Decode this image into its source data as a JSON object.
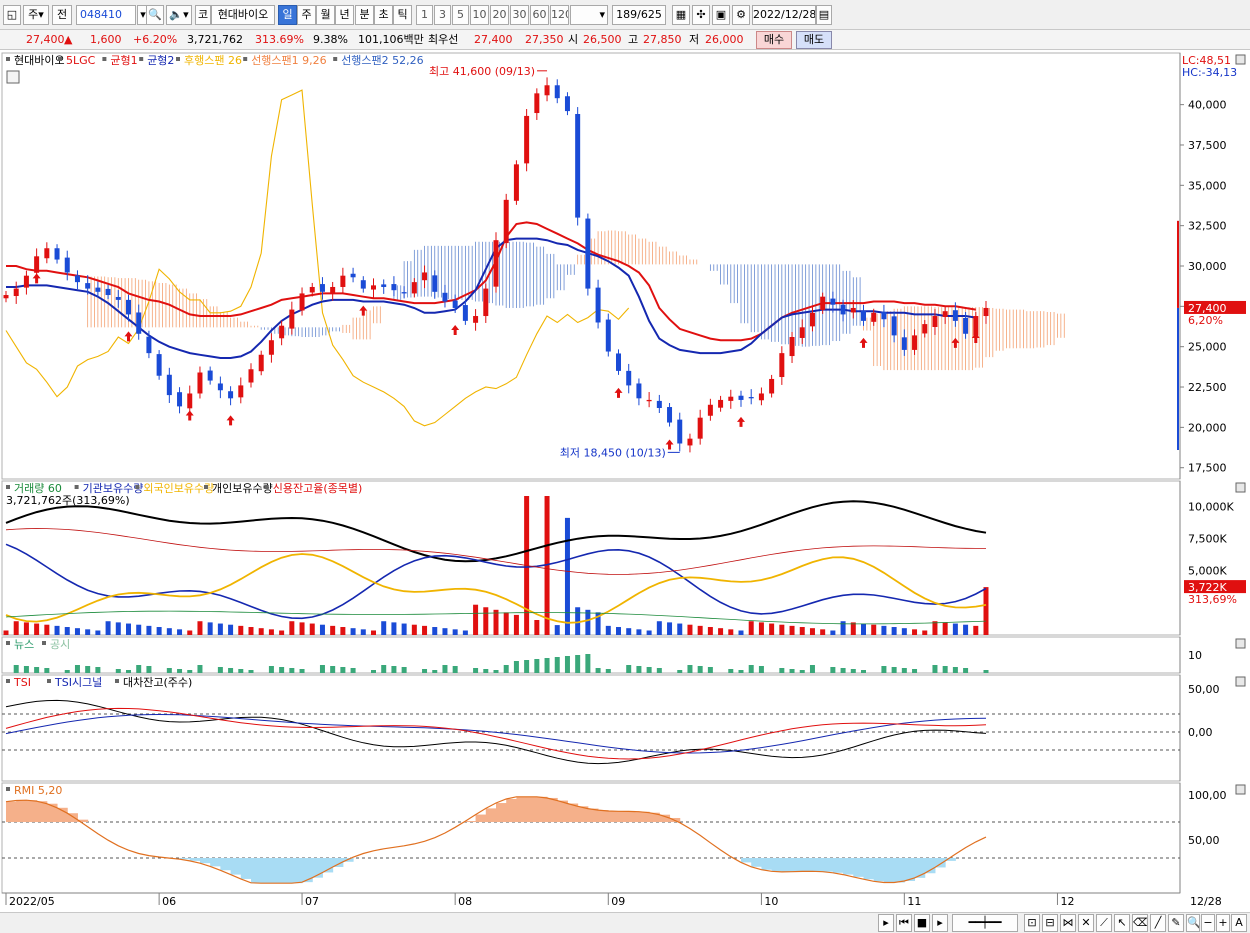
{
  "toolbar": {
    "mode_label": "주",
    "prev_label": "전",
    "stock_code": "048410",
    "code_btn": "코",
    "stock_name": "현대바이오",
    "periods": [
      "일",
      "주",
      "월",
      "년",
      "분",
      "초",
      "틱"
    ],
    "selected_period": "일",
    "intervals": [
      "1",
      "3",
      "5",
      "10",
      "20",
      "30",
      "60",
      "120"
    ],
    "count": "189/625",
    "date": "2022/12/28"
  },
  "pricebar": {
    "price": "27,400",
    "change": "1,600",
    "change_pct": "+6.20%",
    "volume": "3,721,762",
    "vol_ratio": "313.69%",
    "turnover": "9.38%",
    "amount": "101,106백만",
    "best_label": "최우선",
    "best_ask": "27,400",
    "best_bid": "27,350",
    "open_label": "시",
    "open": "26,500",
    "high_label": "고",
    "high": "27,850",
    "low_label": "저",
    "low": "26,000",
    "buy_label": "매수",
    "sell_label": "매도"
  },
  "legend_main": [
    {
      "text": "현대바이오",
      "color": "#000000"
    },
    {
      "text": "5LGC",
      "color": "#e01010"
    },
    {
      "text": "균형1",
      "color": "#e01010"
    },
    {
      "text": "균형2",
      "color": "#1528b0"
    },
    {
      "text": "후행스팬 26",
      "color": "#f0b400"
    },
    {
      "text": "선행스팬1 9,26",
      "color": "#f08040"
    },
    {
      "text": "선행스팬2 52,26",
      "color": "#3060c0"
    }
  ],
  "lc_label": "LC:48,51",
  "hc_label": "HC:-34,13",
  "annotations": {
    "high": "최고 41,600 (09/13)",
    "low": "최저 18,450 (10/13)"
  },
  "last_price_tag": "27,400",
  "last_pct_tag": "6,20%",
  "legend_vol": [
    {
      "text": "거래량  60",
      "color": "#1a8a3a"
    },
    {
      "text": "기관보유수량",
      "color": "#1528b0"
    },
    {
      "text": "외국인보유수량",
      "color": "#f0b400"
    },
    {
      "text": "개인보유수량",
      "color": "#000000"
    },
    {
      "text": "신용잔고율(종목별)",
      "color": "#e01010"
    }
  ],
  "vol_sublabel": "3,721,762주(313,69%)",
  "vol_tag": "3,722K",
  "vol_pct_tag": "313,69%",
  "legend_news": [
    {
      "text": "뉴스",
      "color": "#2a9a6a"
    },
    {
      "text": "공시",
      "color": "#8ac0a0"
    }
  ],
  "legend_tsi": [
    {
      "text": "TSI",
      "color": "#e01010"
    },
    {
      "text": "TSI시그널",
      "color": "#1528b0"
    },
    {
      "text": "대차잔고(주수)",
      "color": "#000000"
    }
  ],
  "legend_rmi": [
    {
      "text": "RMI 5,20",
      "color": "#e07020"
    }
  ],
  "x_labels": [
    "2022/05",
    "06",
    "07",
    "08",
    "09",
    "10",
    "11",
    "12",
    "12/28"
  ],
  "chart_data": [
    {
      "type": "candlestick",
      "title": "현대바이오",
      "y_ticks": [
        "40,000",
        "37,500",
        "35,000",
        "32,500",
        "30,000",
        "27,500",
        "25,000",
        "22,500",
        "20,000",
        "17,500"
      ],
      "ylim": [
        16800,
        43200
      ],
      "high_value": 41600,
      "high_date": "09/13",
      "low_value": 18450,
      "low_date": "10/13",
      "last_close": 27400,
      "series": [
        {
          "name": "현대바이오",
          "values": [
            28200,
            28600,
            29400,
            30600,
            31100,
            30400,
            29600,
            29000,
            28600,
            28400,
            28200,
            27900,
            27000,
            25800,
            24600,
            23200,
            22000,
            21300,
            22100,
            23400,
            22900,
            22300,
            21800,
            22600,
            23600,
            24500,
            25400,
            26300,
            27300,
            28300,
            28700,
            28400,
            28700,
            29400,
            29300,
            28600,
            28800,
            28700,
            28500,
            28300,
            29000,
            29600,
            28400,
            27800,
            27400,
            26600,
            26900,
            28600,
            31600,
            34100,
            36300,
            39300,
            40700,
            41200,
            40400,
            39600,
            33000,
            28600,
            26500,
            24700,
            23500,
            22600,
            21800,
            21700,
            21200,
            20300,
            19000,
            19300,
            20600,
            21400,
            21700,
            21900,
            21700,
            21800,
            22100,
            23000,
            24600,
            25600,
            26200,
            27100,
            28100,
            27600,
            27000,
            27400,
            26600,
            27100,
            26700,
            25700,
            24800,
            25700,
            26400,
            26900,
            27200,
            26600,
            25800,
            26900,
            27400
          ]
        },
        {
          "name": "균형1",
          "values": [
            30000,
            30000,
            29800,
            29700,
            29700,
            29600,
            29500,
            29400,
            29300,
            29100,
            28900,
            28700,
            28300,
            28100,
            27900,
            27800,
            27600,
            27300,
            27000,
            26900,
            26900,
            26900,
            26900,
            27000,
            27200,
            27400,
            27600,
            27900,
            28000,
            28100,
            28200,
            28300,
            28300,
            28300,
            28200,
            28100,
            28000,
            28000,
            27900,
            27800,
            27700,
            27700,
            27700,
            27800,
            27900,
            28200,
            28500,
            29100,
            30300,
            31800,
            32600,
            32700,
            32600,
            32300,
            32000,
            31700,
            31400,
            31000,
            30700,
            30500,
            30300,
            30000,
            29600,
            28800,
            27400,
            26700,
            26100,
            25900,
            25700,
            25500,
            25400,
            25400,
            25400,
            25500,
            25800,
            26300,
            26800,
            27100,
            27300,
            27500,
            27700,
            27700,
            27700,
            27700,
            27700,
            27800,
            27800,
            27800,
            27700,
            27700,
            27600,
            27600,
            27500,
            27500,
            27400,
            27300
          ]
        },
        {
          "name": "균형2",
          "values": [
            28700,
            28700,
            28800,
            28800,
            28800,
            28700,
            28600,
            28500,
            28400,
            28100,
            27700,
            27200,
            26700,
            26200,
            25700,
            25300,
            25000,
            24800,
            24600,
            24500,
            24400,
            24300,
            24300,
            24400,
            24700,
            25300,
            26000,
            26600,
            27000,
            27300,
            27600,
            27800,
            27900,
            27900,
            27900,
            27800,
            27800,
            27800,
            27700,
            27600,
            27400,
            27100,
            27100,
            27200,
            27300,
            27800,
            28500,
            29800,
            31100,
            31600,
            31700,
            31700,
            31700,
            31600,
            31400,
            31300,
            31000,
            30800,
            30600,
            30300,
            29900,
            29400,
            28100,
            26600,
            25500,
            25100,
            24800,
            24700,
            24600,
            24600,
            24600,
            24700,
            24800,
            25200,
            25800,
            26300,
            26800,
            27000,
            27100,
            27200,
            27300,
            27300,
            27300,
            27200,
            27200,
            27200,
            27100,
            27100,
            27100,
            27000,
            27000,
            27000,
            26900,
            26900,
            26900,
            26800
          ]
        },
        {
          "name": "후행스팬 26",
          "values": [
            26000,
            25000,
            24000,
            23600,
            22800,
            21900,
            22500,
            23800,
            24200,
            24400,
            24700,
            25600,
            25200,
            26100,
            27800,
            29800,
            29200,
            28400,
            27900,
            27900,
            27100,
            27100,
            27200,
            27500,
            28700,
            30800,
            36800,
            40300,
            40600,
            40900,
            33800,
            27100,
            25100,
            24200,
            23200,
            22800,
            22500,
            22200,
            21800,
            21300,
            20400,
            20100,
            20300,
            20800,
            21300,
            21800,
            22200,
            22500,
            22400,
            22700,
            23100,
            24500,
            25800,
            26900,
            26500,
            27000,
            26500,
            26800,
            27300,
            27200,
            26700,
            27400
          ]
        }
      ]
    },
    {
      "type": "bar+line",
      "title": "거래량 60",
      "y_ticks": [
        "10,000K",
        "7,500K",
        "5,000K"
      ],
      "last_volume": 3721762
    },
    {
      "type": "line",
      "title": "TSI",
      "y_ticks": [
        "50,00",
        "0,00"
      ]
    },
    {
      "type": "area",
      "title": "RMI 5,20",
      "y_ticks": [
        "100,00",
        "50,00"
      ]
    }
  ],
  "news_tick": "10"
}
